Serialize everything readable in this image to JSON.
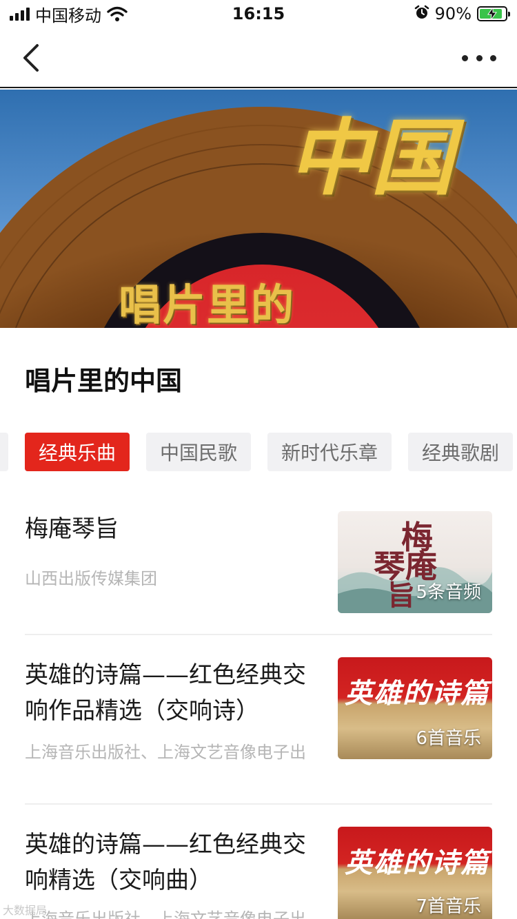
{
  "status_bar": {
    "carrier": "中国移动",
    "time": "16:15",
    "battery": "90%"
  },
  "nav": {
    "back_icon": "chevron-left-icon",
    "more_icon": "more-dots-icon"
  },
  "banner": {
    "title_small": "唱片里的",
    "title_big": "中国"
  },
  "page": {
    "title": "唱片里的中国"
  },
  "tabs": [
    {
      "label": "经典乐曲",
      "active": true
    },
    {
      "label": "中国民歌",
      "active": false
    },
    {
      "label": "新时代乐章",
      "active": false
    },
    {
      "label": "经典歌剧",
      "active": false
    }
  ],
  "items": [
    {
      "title": "梅庵琴旨",
      "publisher": "山西出版传媒集团",
      "count": "5条音频"
    },
    {
      "title": "英雄的诗篇——红色经典交响作品精选（交响诗）",
      "publisher": "上海音乐出版社、上海文艺音像电子出",
      "count": "6首音乐",
      "cover_text": "英雄的诗篇"
    },
    {
      "title": "英雄的诗篇——红色经典交响精选（交响曲）",
      "publisher": "上海音乐出版社、上海文艺音像电子出",
      "count": "7首音乐",
      "cover_text": "英雄的诗篇"
    }
  ],
  "thumb_1_text": {
    "line1": "梅",
    "line2": "琴庵",
    "line3": "旨"
  },
  "watermark": "大数据局",
  "colors": {
    "accent": "#e3261c",
    "tab_bg": "#f1f1f3",
    "muted_text": "#b5b5b5"
  }
}
